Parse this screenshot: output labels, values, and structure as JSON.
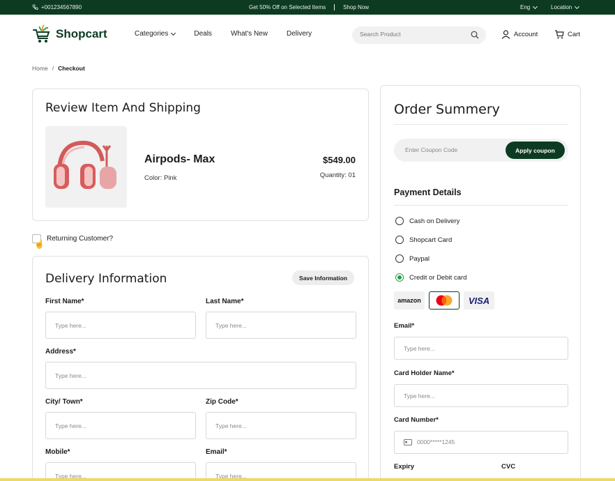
{
  "topbar": {
    "phone": "+001234567890",
    "promo": "Get 50% Off on Selected Items",
    "shop_now": "Shop Now",
    "language": "Eng",
    "location": "Location"
  },
  "header": {
    "brand": "Shopcart",
    "nav": [
      "Categories",
      "Deals",
      "What's New",
      "Delivery"
    ],
    "search_placeholder": "Search Product",
    "account": "Account",
    "cart": "Cart"
  },
  "breadcrumb": {
    "home": "Home",
    "separator": "/",
    "current": "Checkout"
  },
  "review": {
    "title": "Review Item And Shipping",
    "product_name": "Airpods- Max",
    "color": "Color: Pink",
    "price": "$549.00",
    "quantity": "Quantity: 01"
  },
  "returning_customer": "Returning Customer?",
  "delivery": {
    "title": "Delivery Information",
    "save_label": "Save Information",
    "placeholder": "Type here...",
    "fields": {
      "first_name": "First Name*",
      "last_name": "Last Name*",
      "address": "Address*",
      "city": "City/ Town*",
      "zip": "Zip Code*",
      "mobile": "Mobile*",
      "email": "Email*"
    }
  },
  "summary": {
    "title": "Order Summery",
    "coupon_placeholder": "Enter Coupon Code",
    "apply_label": "Apply coupon",
    "payment_title": "Payment Details",
    "options": [
      "Cash on Delivery",
      "Shopcart Card",
      "Paypal",
      "Credit or Debit card"
    ],
    "selected_option": "Credit or Debit card",
    "card_brands": [
      "amazon",
      "mastercard",
      "VISA"
    ],
    "email_label": "Email*",
    "email_placeholder": "Type here...",
    "holder_label": "Card Holder Name*",
    "holder_placeholder": "Type here...",
    "number_label": "Card Number*",
    "number_placeholder": "0000*****1245",
    "expiry_label": "Expiry",
    "cvc_label": "CVC"
  },
  "colors": {
    "brand": "#0d3b22",
    "accent_green": "#2e9b4e",
    "product_pink": "#e06a6a"
  }
}
